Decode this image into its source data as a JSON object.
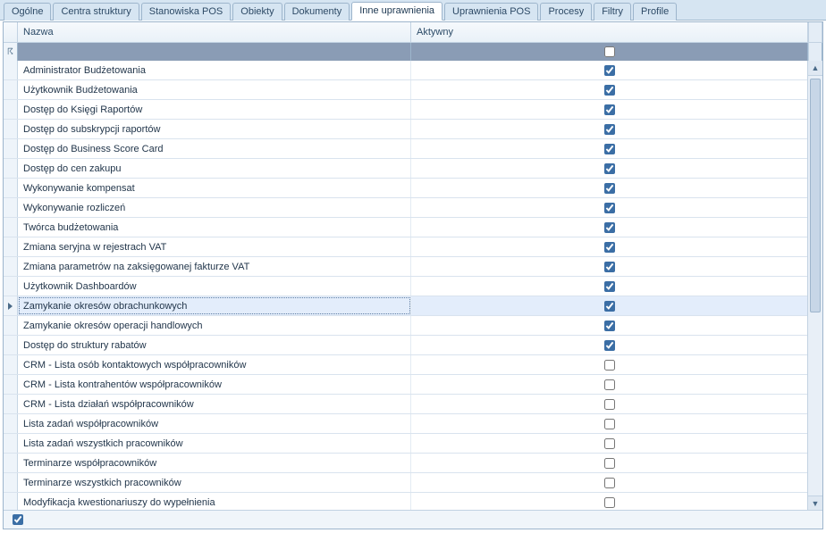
{
  "tabs": [
    {
      "id": "ogolne",
      "label": "Ogólne",
      "active": false
    },
    {
      "id": "centra",
      "label": "Centra struktury",
      "active": false
    },
    {
      "id": "stanowiska",
      "label": "Stanowiska POS",
      "active": false
    },
    {
      "id": "obiekty",
      "label": "Obiekty",
      "active": false
    },
    {
      "id": "dokumenty",
      "label": "Dokumenty",
      "active": false
    },
    {
      "id": "inne",
      "label": "Inne uprawnienia",
      "active": true
    },
    {
      "id": "upr_pos",
      "label": "Uprawnienia POS",
      "active": false
    },
    {
      "id": "procesy",
      "label": "Procesy",
      "active": false
    },
    {
      "id": "filtry",
      "label": "Filtry",
      "active": false
    },
    {
      "id": "profile",
      "label": "Profile",
      "active": false
    }
  ],
  "columns": {
    "name": "Nazwa",
    "active": "Aktywny"
  },
  "filter": {
    "name_filter": "",
    "active_filter": false
  },
  "footer": {
    "show_all": true
  },
  "selected_index": 12,
  "rows": [
    {
      "n": "Administrator Budżetowania",
      "a": true
    },
    {
      "n": "Użytkownik Budżetowania",
      "a": true
    },
    {
      "n": "Dostęp do Księgi Raportów",
      "a": true
    },
    {
      "n": "Dostęp do subskrypcji raportów",
      "a": true
    },
    {
      "n": "Dostęp do Business Score Card",
      "a": true
    },
    {
      "n": "Dostęp do cen zakupu",
      "a": true
    },
    {
      "n": "Wykonywanie kompensat",
      "a": true
    },
    {
      "n": "Wykonywanie rozliczeń",
      "a": true
    },
    {
      "n": "Twórca budżetowania",
      "a": true
    },
    {
      "n": "Zmiana seryjna w rejestrach VAT",
      "a": true
    },
    {
      "n": "Zmiana parametrów na zaksięgowanej fakturze VAT",
      "a": true
    },
    {
      "n": "Użytkownik Dashboardów",
      "a": true
    },
    {
      "n": "Zamykanie okresów obrachunkowych",
      "a": true
    },
    {
      "n": "Zamykanie okresów operacji handlowych",
      "a": true
    },
    {
      "n": "Dostęp do struktury rabatów",
      "a": true
    },
    {
      "n": "CRM - Lista osób kontaktowych współpracowników",
      "a": false
    },
    {
      "n": "CRM - Lista kontrahentów współpracowników",
      "a": false
    },
    {
      "n": "CRM - Lista działań współpracowników",
      "a": false
    },
    {
      "n": "Lista zadań współpracowników",
      "a": false
    },
    {
      "n": "Lista zadań wszystkich pracowników",
      "a": false
    },
    {
      "n": "Terminarze współpracowników",
      "a": false
    },
    {
      "n": "Terminarze wszystkich pracowników",
      "a": false
    },
    {
      "n": "Modyfikacja kwestionariuszy do wypełnienia",
      "a": false
    }
  ]
}
